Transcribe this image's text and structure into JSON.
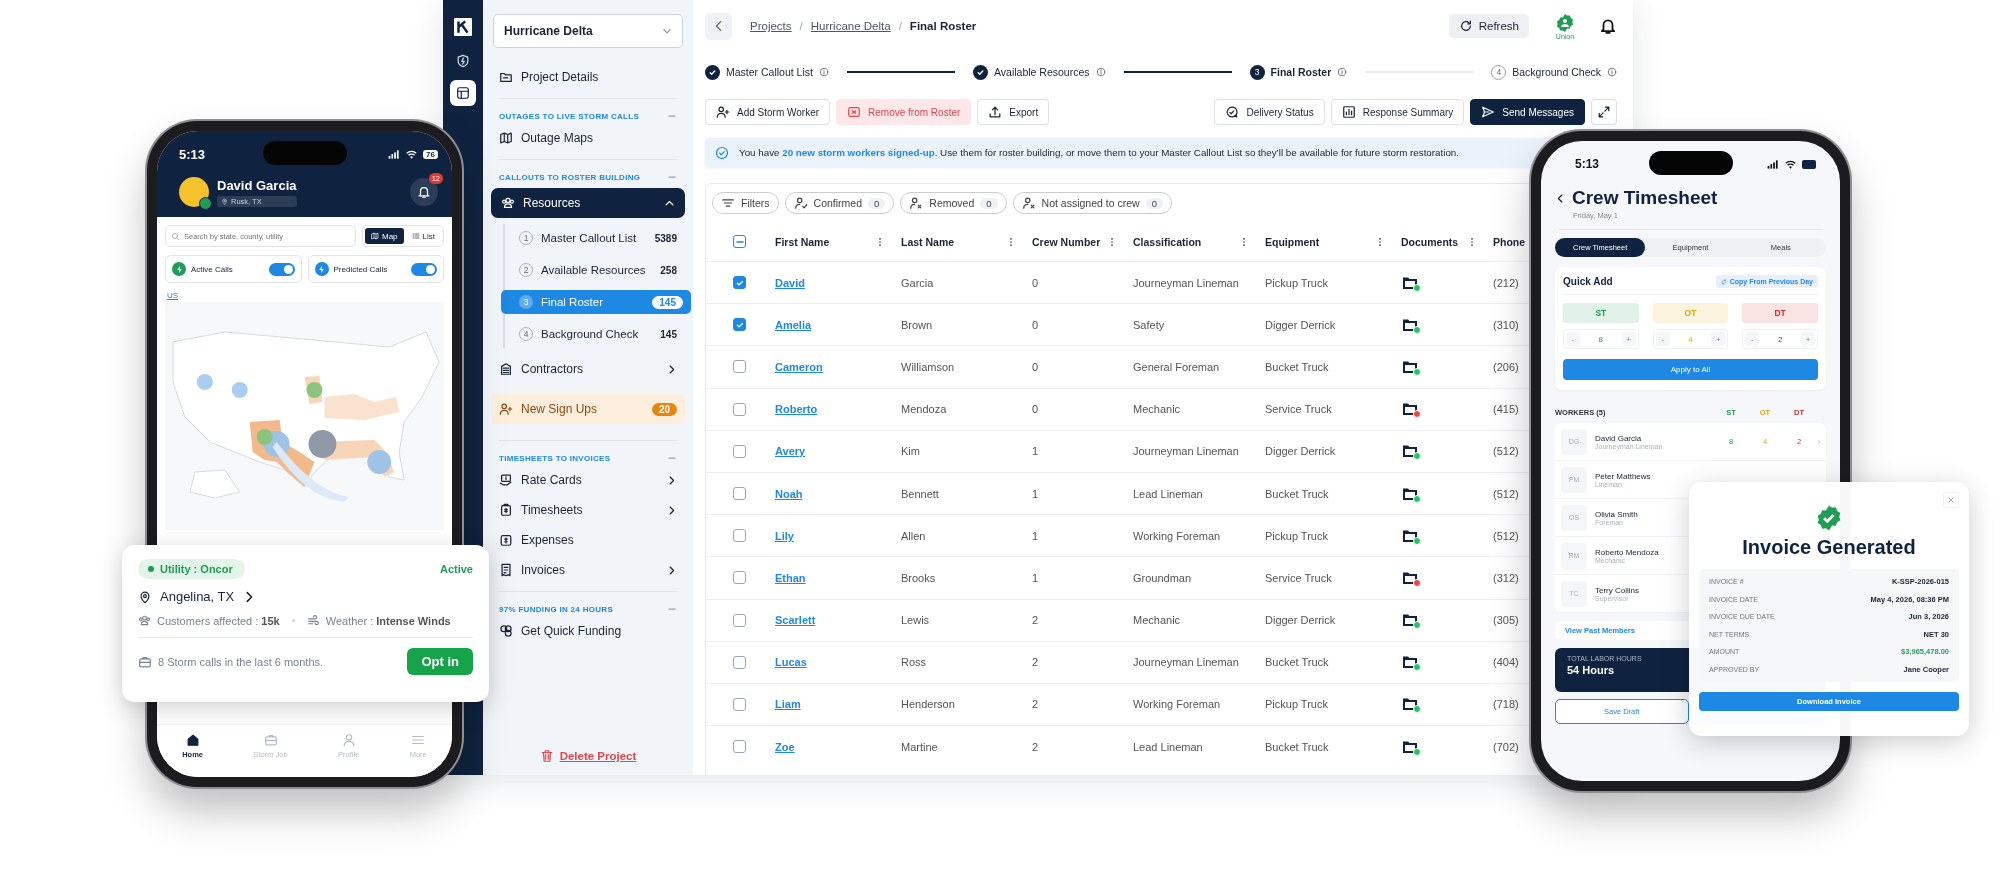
{
  "app": {
    "sidebar": {
      "project_select": "Hurricane Delta",
      "top_item": "Project Details",
      "sections": [
        {
          "title": "OUTAGES TO LIVE STORM CALLS",
          "items": [
            {
              "kind": "link",
              "label": "Outage Maps",
              "chevron": false
            }
          ]
        },
        {
          "title": "CALLOUTS TO ROSTER BUILDING",
          "items": [
            {
              "kind": "group",
              "label": "Resources",
              "expanded": true,
              "children": [
                {
                  "number": "1",
                  "label": "Master Callout List",
                  "count": "5389",
                  "selected": false
                },
                {
                  "number": "2",
                  "label": "Available Resources",
                  "count": "258",
                  "selected": false
                },
                {
                  "number": "3",
                  "label": "Final Roster",
                  "count": "145",
                  "selected": true
                },
                {
                  "number": "4",
                  "label": "Background Check",
                  "count": "145",
                  "selected": false
                }
              ]
            },
            {
              "kind": "link",
              "label": "Contractors",
              "chevron": true
            },
            {
              "kind": "highlight",
              "label": "New Sign Ups",
              "badge": "20"
            }
          ]
        },
        {
          "title": "TIMESHEETS TO INVOICES",
          "items": [
            {
              "kind": "link",
              "label": "Rate Cards",
              "chevron": true
            },
            {
              "kind": "link",
              "label": "Timesheets",
              "chevron": true
            },
            {
              "kind": "link",
              "label": "Expenses",
              "chevron": false
            },
            {
              "kind": "link",
              "label": "Invoices",
              "chevron": true
            }
          ]
        },
        {
          "title": "97% FUNDING IN 24 HOURS",
          "items": [
            {
              "kind": "link",
              "label": "Get Quick Funding",
              "chevron": false
            }
          ]
        }
      ],
      "delete_action": "Delete Project"
    },
    "header": {
      "breadcrumb": [
        {
          "kind": "link",
          "text": "Projects"
        },
        {
          "kind": "separator",
          "text": "/"
        },
        {
          "kind": "link",
          "text": "Hurricane Delta"
        },
        {
          "kind": "separator",
          "text": "/"
        },
        {
          "kind": "current",
          "text": "Final Roster"
        }
      ],
      "refresh": "Refresh",
      "org_badge": "Union"
    },
    "stepper": [
      {
        "label": "Master Callout List",
        "done": true,
        "current": false
      },
      {
        "label": "Available Resources",
        "done": true,
        "current": false
      },
      {
        "number": "3",
        "label": "Final Roster",
        "done": false,
        "current": true
      },
      {
        "number": "4",
        "label": "Background Check",
        "done": false,
        "current": false
      }
    ],
    "toolbar": {
      "left": [
        {
          "kind": "default",
          "label": "Add Storm Worker"
        },
        {
          "kind": "danger",
          "label": "Remove from Roster"
        },
        {
          "kind": "default",
          "label": "Export"
        }
      ],
      "right": [
        {
          "kind": "default",
          "label": "Delivery Status"
        },
        {
          "kind": "default",
          "label": "Response Summary"
        },
        {
          "kind": "primary",
          "label": "Send Messages"
        }
      ]
    },
    "banner": {
      "before": "You have ",
      "link": "20 new storm workers signed-up",
      "after": ". Use them for roster building, or move them to your Master Callout List so they’ll be available for future storm restoration."
    },
    "filters": {
      "label": "Filters",
      "chips": [
        {
          "label": "Confirmed",
          "count": "0"
        },
        {
          "label": "Removed",
          "count": "0"
        },
        {
          "label": "Not assigned to crew",
          "count": "0"
        }
      ]
    },
    "table": {
      "indeterminate": true,
      "columns": [
        "First Name",
        "Last Name",
        "Crew Number",
        "Classification",
        "Equipment",
        "Documents",
        "Phone"
      ],
      "rows": [
        {
          "selected": true,
          "first": "David",
          "last": "Garcia",
          "crew": "0",
          "classification": "Journeyman Lineman",
          "equipment": "Pickup Truck",
          "color": "#22c55e",
          "phone": "(212)"
        },
        {
          "selected": true,
          "first": "Amelia",
          "last": "Brown",
          "crew": "0",
          "classification": "Safety",
          "equipment": "Digger Derrick",
          "color": "#22c55e",
          "phone": "(310)"
        },
        {
          "selected": false,
          "first": "Cameron",
          "last": "Williamson",
          "crew": "0",
          "classification": "General Foreman",
          "equipment": "Bucket Truck",
          "color": "#22c55e",
          "phone": "(206)"
        },
        {
          "selected": false,
          "first": "Roberto",
          "last": "Mendoza",
          "crew": "0",
          "classification": "Mechanic",
          "equipment": "Service Truck",
          "color": "#ef4444",
          "phone": "(415)"
        },
        {
          "selected": false,
          "first": "Avery",
          "last": "Kim",
          "crew": "1",
          "classification": "Journeyman Lineman",
          "equipment": "Digger Derrick",
          "color": "#22c55e",
          "phone": "(512)"
        },
        {
          "selected": false,
          "first": "Noah",
          "last": "Bennett",
          "crew": "1",
          "classification": "Lead Lineman",
          "equipment": "Bucket Truck",
          "color": "#22c55e",
          "phone": "(512)"
        },
        {
          "selected": false,
          "first": "Lily",
          "last": "Allen",
          "crew": "1",
          "classification": "Working Foreman",
          "equipment": "Pickup Truck",
          "color": "#22c55e",
          "phone": "(512)"
        },
        {
          "selected": false,
          "first": "Ethan",
          "last": "Brooks",
          "crew": "1",
          "classification": "Groundman",
          "equipment": "Service Truck",
          "color": "#ef4444",
          "phone": "(312)"
        },
        {
          "selected": false,
          "first": "Scarlett",
          "last": "Lewis",
          "crew": "2",
          "classification": "Mechanic",
          "equipment": "Digger Derrick",
          "color": "#22c55e",
          "phone": "(305)"
        },
        {
          "selected": false,
          "first": "Lucas",
          "last": "Ross",
          "crew": "2",
          "classification": "Journeyman Lineman",
          "equipment": "Bucket Truck",
          "color": "#22c55e",
          "phone": "(404)"
        },
        {
          "selected": false,
          "first": "Liam",
          "last": "Henderson",
          "crew": "2",
          "classification": "Working Foreman",
          "equipment": "Pickup Truck",
          "color": "#22c55e",
          "phone": "(718)"
        },
        {
          "selected": false,
          "first": "Zoe",
          "last": "Martine",
          "crew": "2",
          "classification": "Lead Lineman",
          "equipment": "Bucket Truck",
          "color": "#22c55e",
          "phone": "(702)"
        }
      ]
    }
  },
  "left_phone": {
    "time": "5:13",
    "battery": "76",
    "user": "David Garcia",
    "location": "Rusk, TX",
    "notifications": "12",
    "search_placeholder": "Search by state, county, utility",
    "view_tabs": [
      {
        "label": "Map",
        "selected": true
      },
      {
        "label": "List",
        "selected": false
      }
    ],
    "toggles": [
      {
        "label": "Active Calls",
        "on": true
      },
      {
        "label": "Predicted Calls",
        "on": true
      }
    ],
    "map_link": "US",
    "nav": [
      {
        "label": "Home",
        "selected": true
      },
      {
        "label": "Storm Job",
        "selected": false
      },
      {
        "label": "Profile",
        "selected": false
      },
      {
        "label": "More",
        "selected": false
      }
    ]
  },
  "utility_card": {
    "utility": "Utility : Oncor",
    "status": "Active",
    "location": "Angelina, TX",
    "customers": "Customers affected : **15k**",
    "weather": "Weather : **Intense Winds**",
    "history": "8 Storm calls in the last 6 months.",
    "button": "Opt in"
  },
  "right_phone": {
    "time": "5:13",
    "title": "Crew Timesheet",
    "date": "Friday, May 1",
    "tabs": [
      {
        "label": "Crew Timesheet",
        "selected": true
      },
      {
        "label": "Equipment",
        "selected": false
      },
      {
        "label": "Meals",
        "selected": false
      }
    ],
    "quick_add": {
      "title": "Quick Add",
      "copy": "Copy From Previous Day",
      "apply": "Apply to All",
      "hours": [
        {
          "label": "ST",
          "value": "8",
          "minus": "-",
          "plus": "+",
          "color": "#1f9d55"
        },
        {
          "label": "OT",
          "value": "4",
          "minus": "-",
          "plus": "+",
          "color": "#e0a800"
        },
        {
          "label": "DT",
          "value": "2",
          "minus": "-",
          "plus": "+",
          "color": "#d32f2f"
        }
      ]
    },
    "workers_title": "WORKERS (5)",
    "columns": [
      "ST",
      "OT",
      "DT"
    ],
    "workers": [
      {
        "initials": "DG",
        "name": "David Garcia",
        "role": "Journeyman Lineman",
        "values": [
          "8",
          "4",
          "2"
        ]
      },
      {
        "initials": "PM",
        "name": "Peter Matthews",
        "role": "Lineman"
      },
      {
        "initials": "OS",
        "name": "Olivia Smith",
        "role": "Foreman"
      },
      {
        "initials": "RM",
        "name": "Roberto Mendoza",
        "role": "Mechanic"
      },
      {
        "initials": "TC",
        "name": "Terry Collins",
        "role": "Supervisor"
      }
    ],
    "view_past": "View Past Members",
    "total_label": "TOTAL LABOR HOURS",
    "total": "54 Hours",
    "save": "Save Draft"
  },
  "invoice": {
    "title": "Invoice Generated",
    "fields": [
      {
        "kind": "text",
        "label": "INVOICE #",
        "value": "K-SSP-2026-015"
      },
      {
        "kind": "text",
        "label": "INVOICE DATE",
        "value": "May 4, 2026, 08:36 PM"
      },
      {
        "kind": "text",
        "label": "INVOICE DUE DATE",
        "value": "Jun 3, 2026"
      },
      {
        "kind": "text",
        "label": "NET TERMS",
        "value": "NET 30"
      },
      {
        "kind": "amount",
        "label": "AMOUNT",
        "value": "$3,965,478.00"
      },
      {
        "kind": "text",
        "label": "APPROVED BY",
        "value": "Jane Cooper"
      }
    ],
    "button": "Download Invoice"
  }
}
